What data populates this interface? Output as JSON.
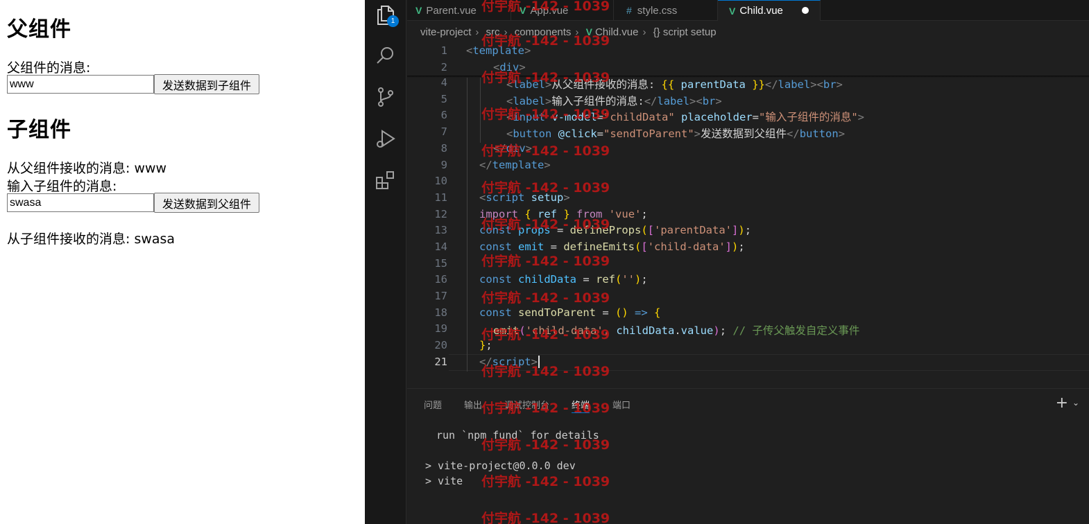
{
  "browser": {
    "parent_heading": "父组件",
    "parent_msg_label": "父组件的消息:",
    "parent_input_value": "www",
    "parent_send_button": "发送数据到子组件",
    "child_heading": "子组件",
    "child_received_line": "从父组件接收的消息: www",
    "child_msg_label": "输入子组件的消息:",
    "child_input_value": "swasa",
    "child_send_button": "发送数据到父组件",
    "parent_received_line": "从子组件接收的消息: swasa"
  },
  "vscode": {
    "explorer_badge": "1",
    "tabs": [
      {
        "label": "Parent.vue",
        "icon": "vue-icon"
      },
      {
        "label": "App.vue",
        "icon": "vue-icon"
      },
      {
        "label": "style.css",
        "icon": "css-icon",
        "icon_glyph": "#"
      },
      {
        "label": "Child.vue",
        "icon": "vue-icon",
        "active": true,
        "modified": true
      }
    ],
    "breadcrumb": [
      "vite-project",
      "src",
      "components",
      "Child.vue",
      "{} script setup"
    ],
    "editor": {
      "line_numbers": [
        "1",
        "2",
        "4",
        "5",
        "6",
        "7",
        "8",
        "9",
        "10",
        "11",
        "12",
        "13",
        "14",
        "15",
        "16",
        "17",
        "18",
        "19",
        "20",
        "21"
      ],
      "lines": {
        "l1": {
          "open": "<",
          "tag": "template",
          "close": ">"
        },
        "l2": {
          "open": "<",
          "tag": "div",
          "close": ">"
        },
        "l4": {
          "t1": "<",
          "tag": "label",
          "t2": ">",
          "text": "从父组件接收的消息: ",
          "mus_open": "{{",
          "expr": " parentData ",
          "mus_close": "}}",
          "t3": "</",
          "tag2": "label",
          "t4": "><",
          "tag3": "br",
          "t5": ">"
        },
        "l5": {
          "t1": "<",
          "tag": "label",
          "t2": ">",
          "text": "输入子组件的消息:",
          "t3": "</",
          "tag2": "label",
          "t4": "><",
          "tag3": "br",
          "t5": ">"
        },
        "l6": {
          "t1": "<",
          "tag": "input",
          "attr1": " v-model",
          "eq1": "=",
          "val1": "\"childData\"",
          "attr2": " placeholder",
          "eq2": "=",
          "val2": "\"输入子组件的消息\"",
          "t2": ">"
        },
        "l7": {
          "t1": "<",
          "tag": "button",
          "attr1": " @click",
          "eq1": "=",
          "val1": "\"sendToParent\"",
          "t2": ">",
          "text": "发送数据到父组件",
          "t3": "</",
          "tag2": "button",
          "t4": ">"
        },
        "l8": {
          "open": "</",
          "tag": "div",
          "close": ">"
        },
        "l9": {
          "open": "</",
          "tag": "template",
          "close": ">"
        },
        "l11": {
          "open": "<",
          "tag": "script",
          "attr": " setup",
          "close": ">"
        },
        "l12": {
          "kw": "import",
          "sp": " ",
          "b_open": "{",
          "name": " ref ",
          "b_close": "}",
          "from": " from ",
          "str": "'vue'",
          "end": ";"
        },
        "l13": {
          "kw": "const",
          "name": " props",
          "op": " = ",
          "fn": "defineProps",
          "p_open": "(",
          "br_open": "[",
          "str": "'parentData'",
          "br_close": "]",
          "p_close": ")",
          "end": ";"
        },
        "l14": {
          "kw": "const",
          "name": " emit",
          "op": " = ",
          "fn": "defineEmits",
          "p_open": "(",
          "br_open": "[",
          "str": "'child-data'",
          "br_close": "]",
          "p_close": ")",
          "end": ";"
        },
        "l16": {
          "kw": "const",
          "name": " childData",
          "op": " = ",
          "fn": "ref",
          "p_open": "(",
          "str": "''",
          "p_close": ")",
          "end": ";"
        },
        "l18": {
          "kw": "const",
          "name": " sendToParent",
          "op": " = ",
          "paren": "()",
          "arrow": " => ",
          "b_open": "{"
        },
        "l19": {
          "fn": "emit",
          "p_open": "(",
          "str": "'child-data'",
          "comma": ", ",
          "obj": "childData",
          "dot": ".",
          "prop": "value",
          "p_close": ")",
          "semi": "; ",
          "comment": "// 子传父触发自定义事件"
        },
        "l20": {
          "b_close": "}",
          "end": ";"
        },
        "l21": {
          "open": "</",
          "tag": "script",
          "close": ">"
        }
      }
    },
    "panel": {
      "tabs": [
        "问题",
        "输出",
        "调试控制台",
        "终端",
        "端口"
      ],
      "active_tab": "终端",
      "terminal_lines": [
        "run `npm fund` for details",
        "> vite-project@0.0.0 dev",
        "> vite"
      ]
    }
  },
  "watermark": "付宇航 -142 - 1039"
}
